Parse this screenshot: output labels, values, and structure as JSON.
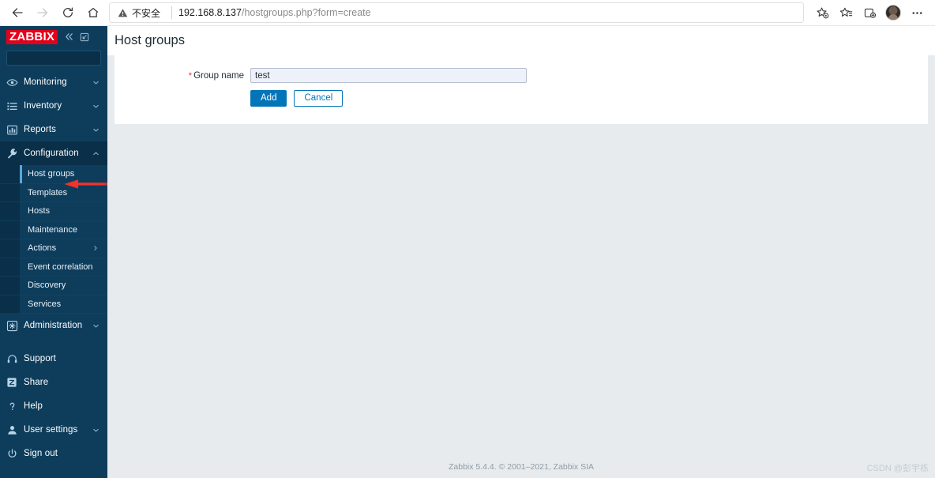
{
  "browser": {
    "back_icon": "arrow-left-icon",
    "forward_icon": "arrow-right-icon",
    "reload_icon": "reload-icon",
    "home_icon": "home-icon",
    "security_label": "不安全",
    "url_host": "192.168.8.137",
    "url_path": "/hostgroups.php?form=create",
    "url_full": "192.168.8.137/hostgroups.php?form=create",
    "toolbar_icons": [
      "add-to-collections-icon",
      "favorites-icon",
      "collections-icon",
      "profile-avatar",
      "more-options-icon"
    ]
  },
  "sidebar": {
    "logo": "ZABBIX",
    "collapse_icon": "chevron-double-left-icon",
    "hide_icon": "collapse-panel-icon",
    "search_placeholder": "",
    "search_value": "",
    "search_icon": "search-icon",
    "items": [
      {
        "label": "Monitoring",
        "icon": "eye-icon",
        "caret": "chevron-down-icon"
      },
      {
        "label": "Inventory",
        "icon": "list-icon",
        "caret": "chevron-down-icon"
      },
      {
        "label": "Reports",
        "icon": "bar-chart-icon",
        "caret": "chevron-down-icon"
      },
      {
        "label": "Configuration",
        "icon": "wrench-icon",
        "caret": "chevron-up-icon"
      }
    ],
    "configuration_submenu": [
      {
        "label": "Host groups",
        "selected": true
      },
      {
        "label": "Templates",
        "selected": false
      },
      {
        "label": "Hosts",
        "selected": false
      },
      {
        "label": "Maintenance",
        "selected": false
      },
      {
        "label": "Actions",
        "selected": false,
        "caret": "chevron-right-icon"
      },
      {
        "label": "Event correlation",
        "selected": false
      },
      {
        "label": "Discovery",
        "selected": false
      },
      {
        "label": "Services",
        "selected": false
      }
    ],
    "bottom_items": [
      {
        "label": "Administration",
        "icon": "gear-icon",
        "caret": "chevron-down-icon"
      },
      {
        "label": "Support",
        "icon": "headset-icon",
        "caret": ""
      },
      {
        "label": "Share",
        "icon": "zabbix-share-icon",
        "caret": ""
      },
      {
        "label": "Help",
        "icon": "question-mark-icon",
        "caret": ""
      },
      {
        "label": "User settings",
        "icon": "user-icon",
        "caret": "chevron-down-icon"
      },
      {
        "label": "Sign out",
        "icon": "power-icon",
        "caret": ""
      }
    ]
  },
  "page": {
    "title": "Host groups",
    "form": {
      "group_name_label": "Group name",
      "required_mark": "*",
      "group_name_value": "test",
      "group_name_placeholder": "",
      "add_label": "Add",
      "cancel_label": "Cancel"
    },
    "footer": "Zabbix 5.4.4. © 2001–2021, Zabbix SIA",
    "watermark": "CSDN @彭宇栋"
  },
  "annotation": {
    "arrow_color": "#f5312a",
    "points_at": "Host groups"
  }
}
